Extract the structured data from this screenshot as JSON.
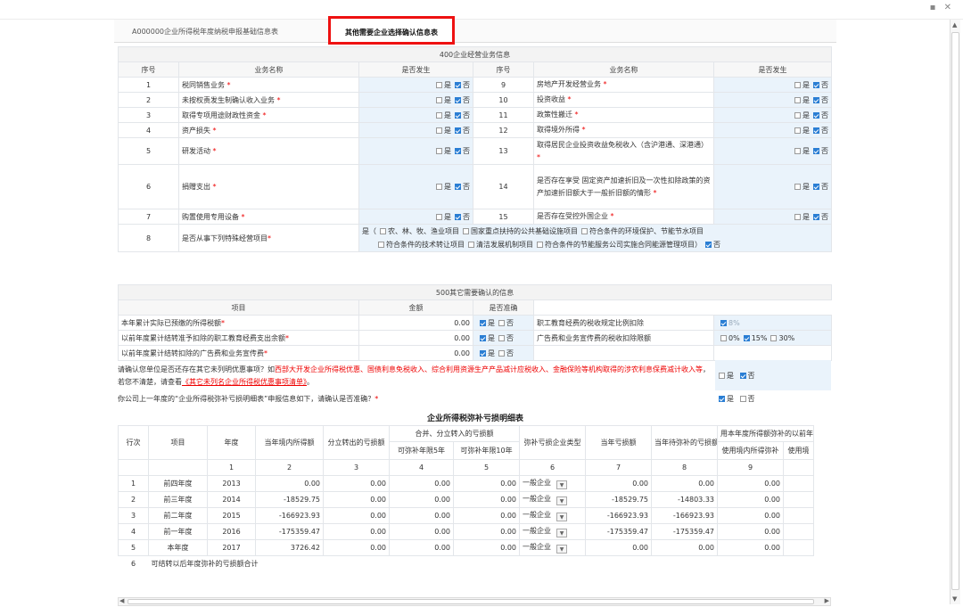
{
  "tabs": [
    "A000000企业所得税年度纳税申报基础信息表",
    "其他需要企业选择确认信息表"
  ],
  "yes": "是",
  "no": "否",
  "sec400": {
    "title": "400企业经营业务信息",
    "headers": [
      "序号",
      "业务名称",
      "是否发生",
      "序号",
      "业务名称",
      "是否发生"
    ],
    "rows": [
      {
        "n1": "1",
        "name1": "税同销售业务",
        "y1": false,
        "n2": "9",
        "name2": "房地产开发经营业务",
        "y2": false
      },
      {
        "n1": "2",
        "name1": "未按权责发生制确认收入业务",
        "y1": false,
        "n2": "10",
        "name2": "投资收益",
        "y2": false
      },
      {
        "n1": "3",
        "name1": "取得专项用途财政性资金",
        "y1": false,
        "n2": "11",
        "name2": "政策性搬迁",
        "y2": false
      },
      {
        "n1": "4",
        "name1": "资产损失",
        "y1": false,
        "n2": "12",
        "name2": "取得境外所得",
        "y2": false
      },
      {
        "n1": "5",
        "name1": "研发活动",
        "y1": false,
        "n2": "13",
        "name2": "取得居民企业投资收益免税收入（含沪港通、深港通）",
        "y2": false
      },
      {
        "n1": "6",
        "name1": "捐赠支出",
        "y1": false,
        "n2": "14",
        "name2": "是否存在享受 固定资产加速折旧及一次性扣除政策的资产加速折旧额大于一般折旧额的情形",
        "y2": false
      },
      {
        "n1": "7",
        "name1": "购置使用专用设备",
        "y1": false,
        "n2": "15",
        "name2": "是否存在受控外国企业",
        "y2": false
      }
    ],
    "row8": {
      "n": "8",
      "name": "是否从事下列特殊经营项目",
      "line1": [
        "农、林、牧、渔业项目",
        "国家重点扶持的公共基础设施项目",
        "符合条件的环境保护、节能节水项目"
      ],
      "line2": [
        "符合条件的技术转让项目",
        "清洁发展机制项目",
        "符合条件的节能服务公司实施合同能源管理项目"
      ]
    }
  },
  "sec500": {
    "title": "500其它需要确认的信息",
    "headers": [
      "项目",
      "金额",
      "是否准确"
    ],
    "rows": [
      {
        "label": "本年累计实际已预缴的所得税额",
        "amount": "0.00",
        "right": "职工教育经费的税收规定比例扣除",
        "rightOpts": [
          "8%"
        ]
      },
      {
        "label": "以前年度累计结转准予扣除的职工教育经费支出余额",
        "amount": "0.00",
        "right": "广告费和业务宣传费的税收扣除限额",
        "rightOpts": [
          "0%",
          "15%",
          "30%"
        ]
      },
      {
        "label": "以前年度累计结转扣除的广告费和业务宣传费",
        "amount": "0.00",
        "right": "",
        "rightOpts": []
      }
    ]
  },
  "notice": {
    "q1_pre": "请确认您单位是否还存在其它未列明优惠事项？如",
    "q1_red": "西部大开发企业所得税优惠、国债利息免税收入、综合利用资源生产产品减计应税收入、金融保险等机构取得的涉农利息保费减计收入等",
    "q1_mid": "，若您不清楚，请查看",
    "q1_link": "《其它未列名企业所得税优惠事项清单》",
    "q1_end": "。",
    "q2": "你公司上一年度的“企业所得税弥补亏损明细表”申报信息如下，请确认是否准确？"
  },
  "loss": {
    "title": "企业所得税弥补亏损明细表",
    "h_lineno": "行次",
    "h_item": "项目",
    "h_year": "年度",
    "h_income": "当年境内所得额",
    "h_split_out": "分立转出的亏损额",
    "h_merge_in": "合并、分立转入的亏损额",
    "h_5yr": "可弥补年限5年",
    "h_10yr": "可弥补年限10年",
    "h_type": "弥补亏损企业类型",
    "h_curloss": "当年亏损额",
    "h_remain": "当年待弥补的亏损额",
    "h_used_group": "用本年度所得额弥补的以前年度亏损额",
    "h_used_domestic": "使用境内所得弥补",
    "h_used_foreign": "使用境",
    "colnums": [
      "1",
      "2",
      "3",
      "4",
      "5",
      "6",
      "7",
      "8",
      "9"
    ],
    "rows": [
      {
        "no": "1",
        "item": "前四年度",
        "year": "2013",
        "income": "0.00",
        "split": "0.00",
        "m5": "0.00",
        "m10": "0.00",
        "type": "一般企业",
        "cur": "0.00",
        "remain": "0.00",
        "used": "0.00"
      },
      {
        "no": "2",
        "item": "前三年度",
        "year": "2014",
        "income": "-18529.75",
        "split": "0.00",
        "m5": "0.00",
        "m10": "0.00",
        "type": "一般企业",
        "cur": "-18529.75",
        "remain": "-14803.33",
        "used": "0.00"
      },
      {
        "no": "3",
        "item": "前二年度",
        "year": "2015",
        "income": "-166923.93",
        "split": "0.00",
        "m5": "0.00",
        "m10": "0.00",
        "type": "一般企业",
        "cur": "-166923.93",
        "remain": "-166923.93",
        "used": "0.00"
      },
      {
        "no": "4",
        "item": "前一年度",
        "year": "2016",
        "income": "-175359.47",
        "split": "0.00",
        "m5": "0.00",
        "m10": "0.00",
        "type": "一般企业",
        "cur": "-175359.47",
        "remain": "-175359.47",
        "used": "0.00"
      },
      {
        "no": "5",
        "item": "本年度",
        "year": "2017",
        "income": "3726.42",
        "split": "0.00",
        "m5": "0.00",
        "m10": "0.00",
        "type": "一般企业",
        "cur": "0.00",
        "remain": "0.00",
        "used": "0.00"
      }
    ],
    "row6": {
      "no": "6",
      "label": "可结转以后年度弥补的亏损额合计"
    }
  }
}
